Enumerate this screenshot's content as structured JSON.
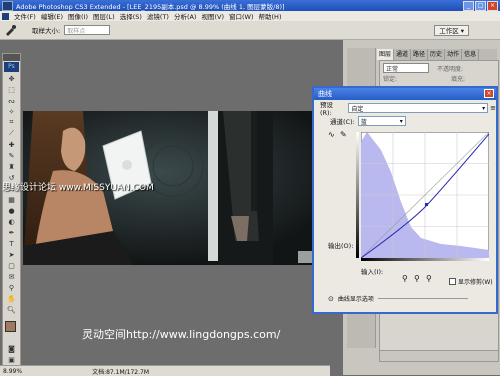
{
  "window": {
    "title": "Adobe Photoshop CS3 Extended - [LEE_2195副本.psd @ 8.99% (曲线 1, 图层蒙版/8)]",
    "controls": [
      "_",
      "□",
      "×"
    ]
  },
  "menu": [
    "文件(F)",
    "编辑(E)",
    "图像(I)",
    "图层(L)",
    "选择(S)",
    "滤镜(T)",
    "分析(A)",
    "视图(V)",
    "窗口(W)",
    "帮助(H)"
  ],
  "options": {
    "sample_label": "取样大小:",
    "sample_value": "取样点",
    "workspace": "工作区 ▾"
  },
  "layers_panel": {
    "tabs": [
      "图层",
      "通道",
      "路径",
      "历史",
      "动作",
      "信息"
    ],
    "blend_mode": "正常",
    "opacity_label": "不透明度:",
    "lock_label": "锁定:",
    "fill_label": "填充:"
  },
  "curves": {
    "title": "曲线",
    "preset_label": "预设(R):",
    "preset_value": "自定",
    "channel_label": "通道(C):",
    "channel_value": "蓝",
    "output_label": "输出(O):",
    "input_label": "输入(I):",
    "show_clipping": "显示修剪(W)",
    "display_options": "曲线显示选项"
  },
  "status": {
    "zoom": "8.99%",
    "doc_size": "文档:87.1M/172.7M"
  },
  "watermarks": {
    "left": "思缘设计论坛 www.MISSYUAN.COM",
    "bottom": "灵动空间http://www.lingdongps.com/"
  }
}
